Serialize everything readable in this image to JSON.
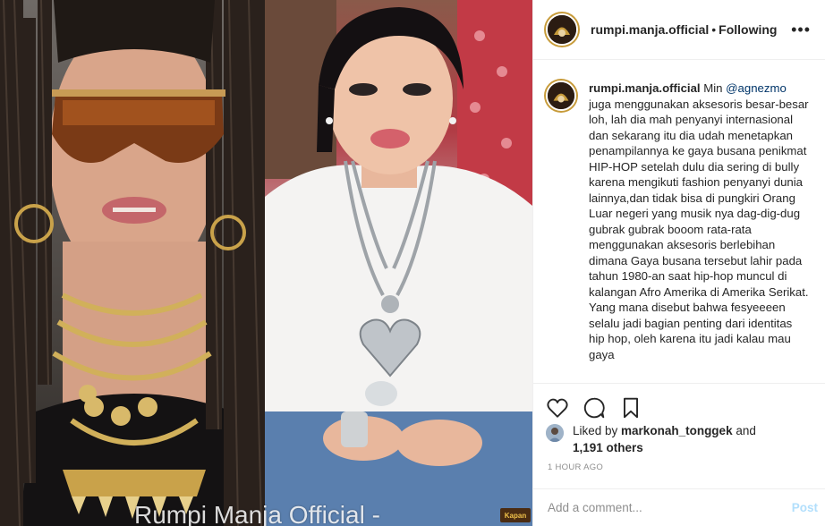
{
  "post": {
    "username": "rumpi.manja.official",
    "follow_status": "Following",
    "separator": "•",
    "more_label": "•••",
    "caption_user": "rumpi.manja.official",
    "caption_pre": "Min ",
    "caption_mention": "@agnezmo",
    "caption_body": "juga menggunakan aksesoris besar-besar loh, lah dia mah penyanyi internasional dan sekarang itu dia udah menetapkan penampilannya ke gaya busana penikmat HIP-HOP setelah dulu dia sering di bully karena mengikuti fashion penyanyi dunia lainnya,dan tidak bisa di pungkiri Orang Luar negeri yang musik nya dag-dig-dug gubrak gubrak booom rata-rata menggunakan aksesoris berlebihan dimana Gaya busana tersebut lahir pada tahun 1980-an saat hip-hop muncul di kalangan Afro Amerika di Amerika Serikat. Yang mana disebut bahwa fesyeeeen selalu jadi bagian penting dari identitas hip hop, oleh karena itu jadi kalau mau gaya",
    "likes_prefix": "Liked by ",
    "liked_by_user": "markonah_tonggek",
    "likes_mid": " and",
    "likes_count": "1,191 others",
    "timestamp": "1 HOUR AGO"
  },
  "image": {
    "watermark": "Rumpi Manja Official -",
    "corner_badge": "Kapan"
  },
  "comment_box": {
    "placeholder": "Add a comment...",
    "post_label": "Post"
  },
  "icons": {
    "heart": "heart-icon",
    "comment": "comment-icon",
    "bookmark": "bookmark-icon",
    "more": "more-options-icon"
  },
  "colors": {
    "text": "#262626",
    "muted": "#8e8e8e",
    "link": "#003569",
    "post_disabled": "#b2dffc",
    "story_ring": "#c79b3a"
  }
}
